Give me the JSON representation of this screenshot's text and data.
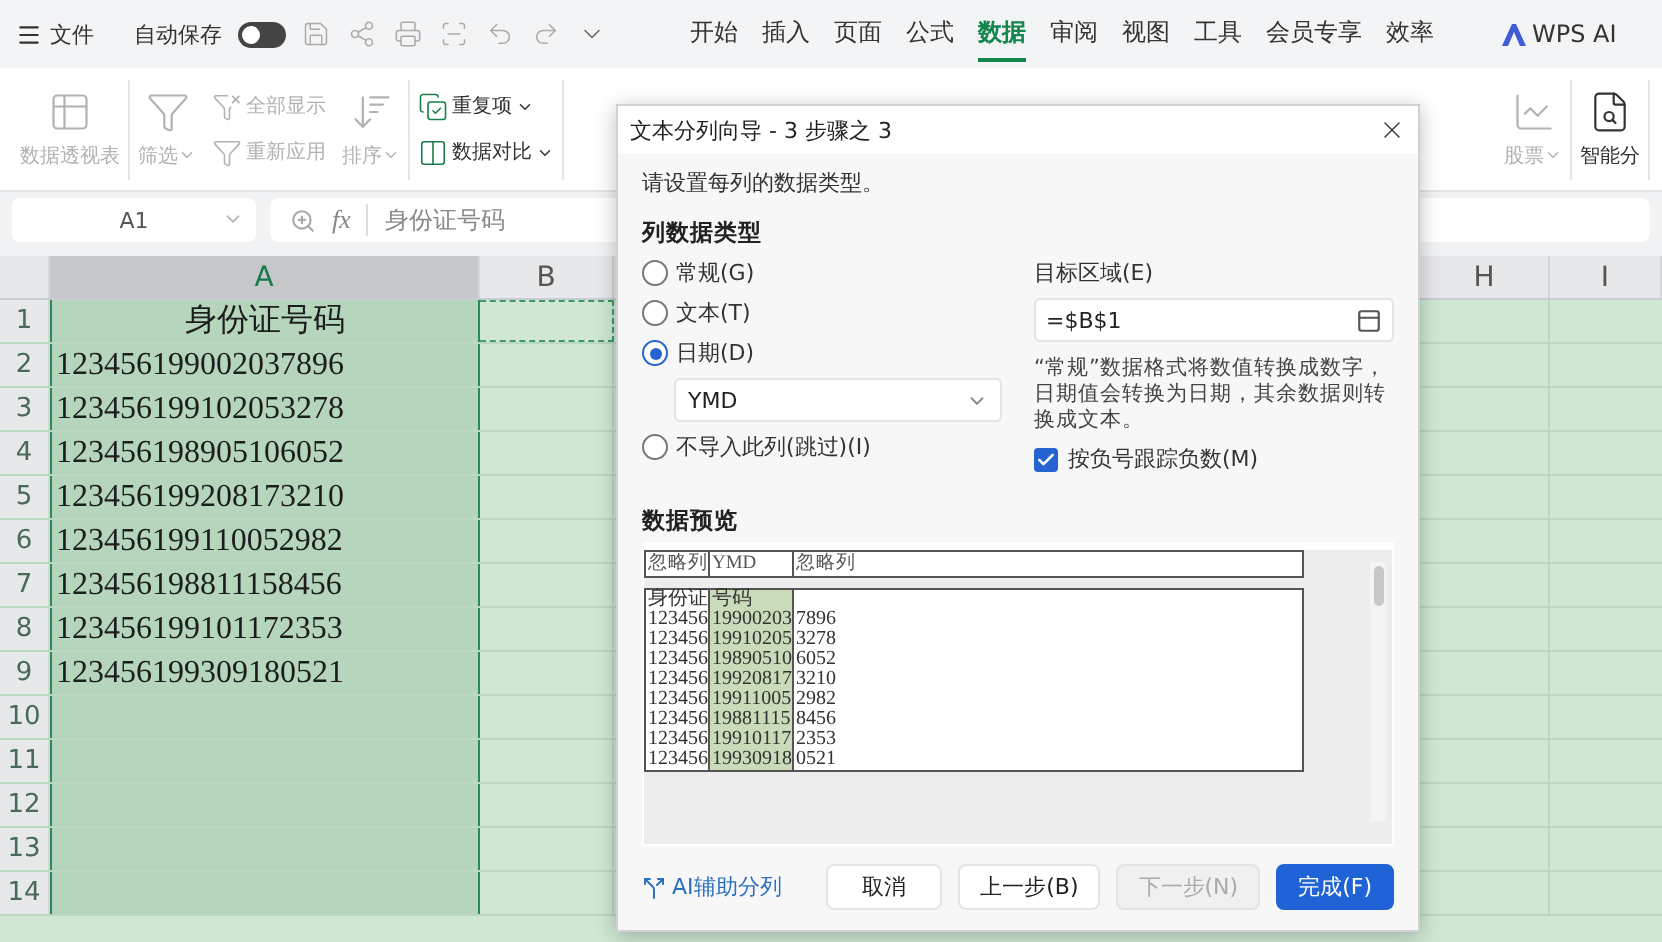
{
  "menu_bar": {
    "file_menu": "文件",
    "autosave": {
      "label": "自动保存",
      "on": false
    },
    "tabs": [
      {
        "label": "开始",
        "selected": false
      },
      {
        "label": "插入",
        "selected": false
      },
      {
        "label": "页面",
        "selected": false
      },
      {
        "label": "公式",
        "selected": false
      },
      {
        "label": "数据",
        "selected": true
      },
      {
        "label": "审阅",
        "selected": false
      },
      {
        "label": "视图",
        "selected": false
      },
      {
        "label": "工具",
        "selected": false
      },
      {
        "label": "会员专享",
        "selected": false
      },
      {
        "label": "效率",
        "selected": false
      }
    ],
    "ai_button": "WPS AI"
  },
  "ribbon": {
    "left": [
      {
        "kind": "large",
        "label": "数据透视表",
        "disabled": true,
        "dropdown": false
      },
      {
        "kind": "large",
        "label": "筛选",
        "disabled": true,
        "dropdown": true
      },
      {
        "kind": "stack",
        "items": [
          {
            "label": "全部显示",
            "disabled": true,
            "dropdown": false
          },
          {
            "label": "重新应用",
            "disabled": true,
            "dropdown": false
          }
        ]
      },
      {
        "kind": "large",
        "label": "排序",
        "disabled": true,
        "dropdown": true
      },
      {
        "kind": "stack",
        "items": [
          {
            "label": "重复项",
            "disabled": false,
            "dropdown": true
          },
          {
            "label": "数据对比",
            "disabled": false,
            "dropdown": true
          }
        ]
      }
    ],
    "right": [
      {
        "kind": "large",
        "label": "股票",
        "disabled": true,
        "dropdown": true
      },
      {
        "kind": "large",
        "label": "智能分",
        "disabled": false,
        "dropdown": false
      }
    ]
  },
  "formula_bar": {
    "cell_name": "A1",
    "fx": "fx",
    "content": "身份证号码"
  },
  "sheet": {
    "columns": [
      {
        "label": "A",
        "selected": true
      },
      {
        "label": "B",
        "selected": false
      },
      {
        "label": "H",
        "selected": false
      },
      {
        "label": "I",
        "selected": false
      }
    ],
    "rows": [
      {
        "number": "1",
        "value": "身份证号码"
      },
      {
        "number": "2",
        "value": "123456199002037896"
      },
      {
        "number": "3",
        "value": "123456199102053278"
      },
      {
        "number": "4",
        "value": "123456198905106052"
      },
      {
        "number": "5",
        "value": "123456199208173210"
      },
      {
        "number": "6",
        "value": "123456199110052982"
      },
      {
        "number": "7",
        "value": "123456198811158456"
      },
      {
        "number": "8",
        "value": "123456199101172353"
      },
      {
        "number": "9",
        "value": "123456199309180521"
      },
      {
        "number": "10"
      },
      {
        "number": "11"
      },
      {
        "number": "12"
      },
      {
        "number": "13"
      },
      {
        "number": "14"
      }
    ]
  },
  "dialog": {
    "title": "文本分列向导 - 3 步骤之 3",
    "instruction": "请设置每列的数据类型。",
    "column_type": {
      "heading": "列数据类型",
      "options": [
        {
          "label": "常规(G)",
          "selected": false
        },
        {
          "label": "文本(T)",
          "selected": false
        },
        {
          "label": "日期(D)",
          "selected": true,
          "format": "YMD"
        },
        {
          "label": "不导入此列(跳过)(I)",
          "selected": false
        }
      ]
    },
    "target": {
      "label": "目标区域(E)",
      "value": "=$B$1"
    },
    "note": "“常规”数据格式将数值转换成数字，日期值会转换为日期，其余数据则转换成文本。",
    "track_negative": {
      "label": "按负号跟踪负数(M)",
      "checked": true
    },
    "preview": {
      "heading": "数据预览",
      "columns": [
        {
          "type": "忽略列",
          "selected": false
        },
        {
          "type": "YMD",
          "selected": true
        },
        {
          "type": "忽略列",
          "selected": false
        }
      ],
      "rows": [
        [
          "身份证",
          "号码"
        ],
        [
          "123456",
          "19900203",
          "7896"
        ],
        [
          "123456",
          "19910205",
          "3278"
        ],
        [
          "123456",
          "19890510",
          "6052"
        ],
        [
          "123456",
          "19920817",
          "3210"
        ],
        [
          "123456",
          "19911005",
          "2982"
        ],
        [
          "123456",
          "19881115",
          "8456"
        ],
        [
          "123456",
          "19910117",
          "2353"
        ],
        [
          "123456",
          "19930918",
          "0521"
        ]
      ]
    },
    "ai_link": "AI辅助分列",
    "buttons": [
      {
        "label": "取消",
        "kind": "normal",
        "disabled": false
      },
      {
        "label": "上一步(B)",
        "kind": "normal",
        "disabled": false
      },
      {
        "label": "下一步(N)",
        "kind": "normal",
        "disabled": true
      },
      {
        "label": "完成(F)",
        "kind": "primary",
        "disabled": false
      }
    ]
  }
}
